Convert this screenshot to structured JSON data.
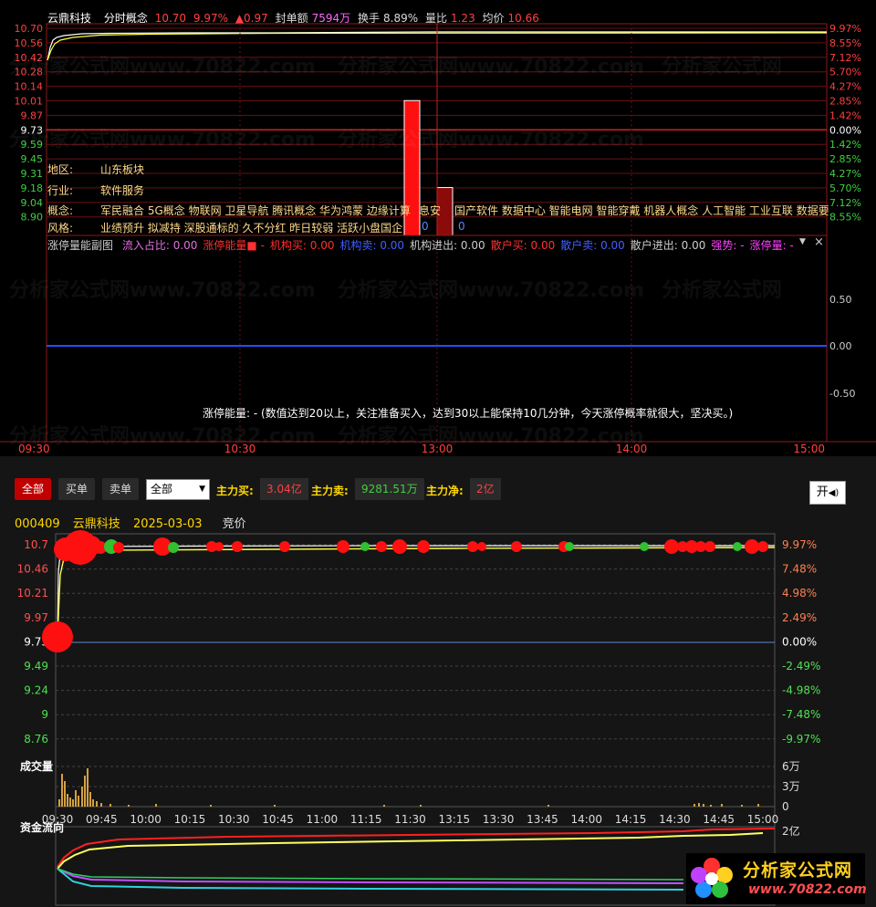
{
  "top_panel": {
    "stock_name": "云鼎科技",
    "chart_title": "分时概念",
    "price": "10.70",
    "pct": "9.97%",
    "change": "▲0.97",
    "seal_label": "封单额",
    "seal_value": "7594万",
    "turnover_label": "换手",
    "turnover_value": "8.89%",
    "volratio_label": "量比",
    "volratio_value": "1.23",
    "avg_label": "均价",
    "avg_value": "10.66",
    "left_ticks": [
      "10.70",
      "10.56",
      "10.42",
      "10.28",
      "10.14",
      "10.01",
      "9.87",
      "9.73",
      "9.59",
      "9.45",
      "9.31",
      "9.18",
      "9.04",
      "8.90"
    ],
    "right_ticks": [
      "9.97%",
      "8.55%",
      "7.12%",
      "5.70%",
      "4.27%",
      "2.85%",
      "1.42%",
      "0.00%",
      "1.42%",
      "2.85%",
      "4.27%",
      "5.70%",
      "7.12%",
      "8.55%"
    ],
    "info": {
      "region_label": "地区:",
      "region_value": "山东板块",
      "industry_label": "行业:",
      "industry_value": "软件服务",
      "concept_label": "概念:",
      "concept_value": "军民融合 5G概念 物联网 卫星导航 腾讯概念 华为鸿蒙 边缘计算",
      "concept_value_2": "国产软件 数据中心 智能电网 智能穿戴 机器人概念 人工智能 工业互联 数据要",
      "style_label": "风格:",
      "style_value": "业绩预升 拟减持 深股通标的 久不分红 昨日较弱 活跃小盘国企"
    },
    "overlap_labels": [
      "息安",
      "0",
      "0"
    ]
  },
  "sub_panel": {
    "title": "涨停量能副图",
    "items": [
      {
        "label": "流入占比:",
        "value": "0.00",
        "color": "#e070e0"
      },
      {
        "label": "涨停能量",
        "value": "-",
        "color": "#ff3030"
      },
      {
        "label": "机构买:",
        "value": "0.00",
        "color": "#ff3030"
      },
      {
        "label": "机构卖:",
        "value": "0.00",
        "color": "#4060ff"
      },
      {
        "label": "机构进出:",
        "value": "0.00",
        "color": "#cccccc"
      },
      {
        "label": "散户买:",
        "value": "0.00",
        "color": "#ff3030"
      },
      {
        "label": "散户卖:",
        "value": "0.00",
        "color": "#4060ff"
      },
      {
        "label": "散户进出:",
        "value": "0.00",
        "color": "#cccccc"
      },
      {
        "label": "强势:",
        "value": "-",
        "color": "#ff40ff"
      },
      {
        "label": "涨停量:",
        "value": "-",
        "color": "#ff40ff"
      }
    ],
    "right_ticks": [
      "0.50",
      "0.00",
      "-0.50"
    ],
    "note": "涨停能量: - (数值达到20以上，关注准备买入，达到30以上能保持10几分钟，今天涨停概率就很大，坚决买。)",
    "dropdown_icon": "▼",
    "close_icon": "×"
  },
  "time_axis_top": [
    "09:30",
    "10:30",
    "13:00",
    "14:00",
    "15:00"
  ],
  "toolbar": {
    "all": "全部",
    "buy": "买单",
    "sell": "卖单",
    "select_value": "全部",
    "main_buy_label": "主力买:",
    "main_buy_value": "3.04亿",
    "main_sell_label": "主力卖:",
    "main_sell_value": "9281.51万",
    "main_net_label": "主力净:",
    "main_net_value": "2亿",
    "toggle_label": "开"
  },
  "stock_line": {
    "code": "000409",
    "name": "云鼎科技",
    "date": "2025-03-03",
    "auction": "竞价"
  },
  "bottom_chart": {
    "left_ticks": [
      "10.7",
      "10.46",
      "10.21",
      "9.97",
      "9.73",
      "9.49",
      "9.24",
      "9",
      "8.76"
    ],
    "right_ticks": [
      "9.97%",
      "7.48%",
      "4.98%",
      "2.49%",
      "0.00%",
      "-2.49%",
      "-4.98%",
      "-7.48%",
      "-9.97%"
    ],
    "volume_label": "成交量",
    "volume_ticks": [
      "6万",
      "3万",
      "0"
    ],
    "time_ticks": [
      "09:30",
      "09:45",
      "10:00",
      "10:15",
      "10:30",
      "10:45",
      "11:00",
      "11:15",
      "11:30",
      "13:15",
      "13:30",
      "13:45",
      "14:00",
      "14:15",
      "14:30",
      "14:45",
      "15:00"
    ],
    "flow_label": "资金流向",
    "flow_tick": "2亿"
  },
  "chart_data": {
    "type": "line",
    "x": [
      "09:30",
      "10:30",
      "13:00",
      "14:00",
      "15:00"
    ],
    "series": [],
    "ylim": [
      8.9,
      10.7
    ],
    "prev_close": 9.73,
    "limit_price": 10.7,
    "bars": [
      {
        "time": "13:00",
        "value": 10.01,
        "color": "#ff1010"
      },
      {
        "time": "13:05",
        "value": 9.18,
        "color": "#8b0a0a"
      }
    ]
  },
  "watermark": {
    "brand": "分析家公式网",
    "url": "www.70822.com",
    "logo_text": "分析家公式网",
    "logo_url": "www.70822.com"
  }
}
